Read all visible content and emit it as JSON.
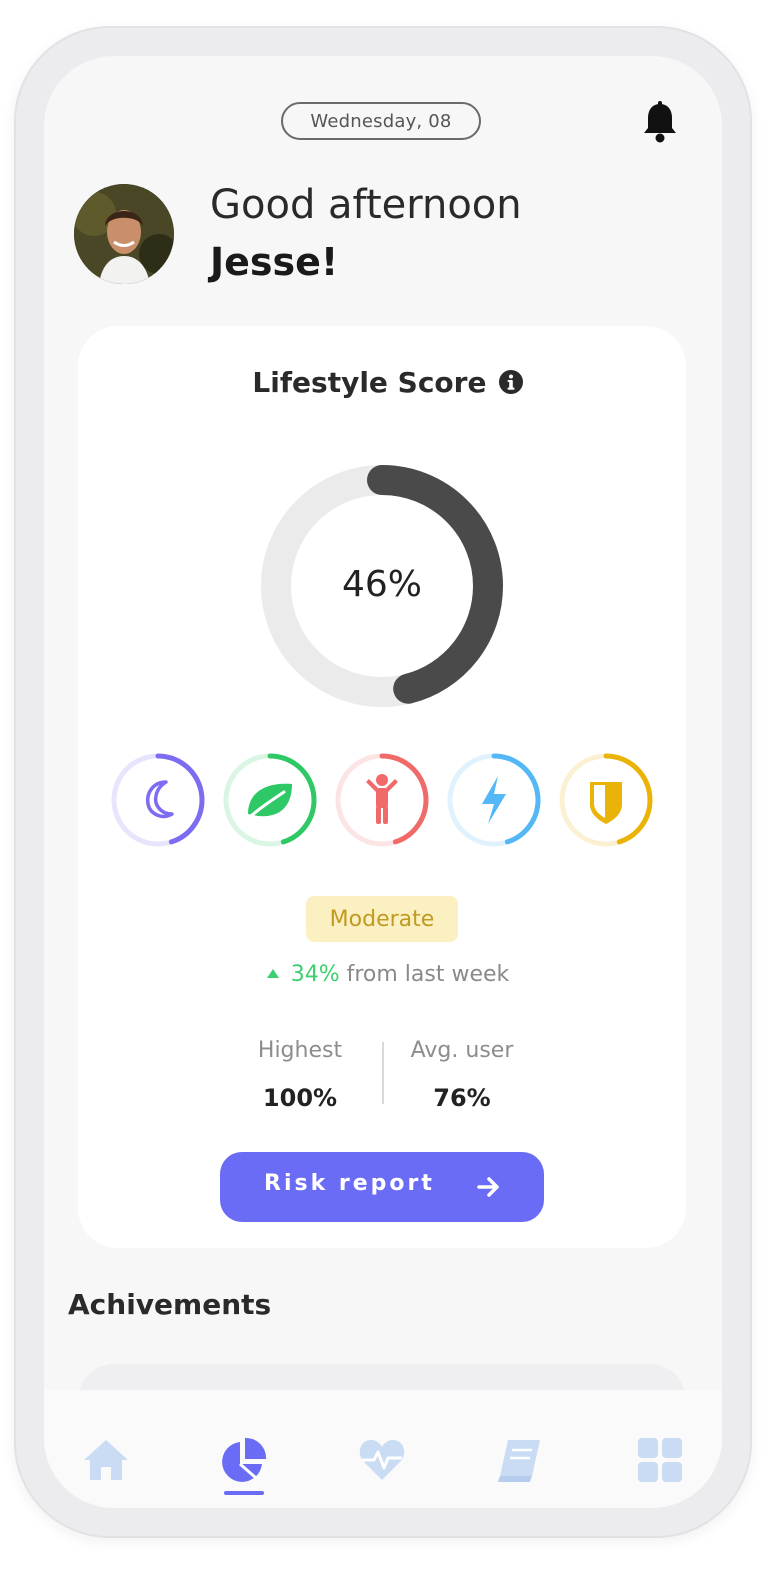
{
  "header": {
    "date": "Wednesday, 08",
    "notification_icon": "bell-icon"
  },
  "greeting": {
    "line1": "Good afternoon",
    "name": "Jesse!"
  },
  "lifestyle_score": {
    "title": "Lifestyle Score",
    "info_icon": "info-icon",
    "score_text": "46%",
    "score_value": 46,
    "ring_color": "#4a4a4a",
    "track_color": "#ebebeb",
    "categories": [
      {
        "icon": "moon-icon",
        "color": "#7b6cf2",
        "progress": 0.45
      },
      {
        "icon": "leaf-icon",
        "color": "#2fc866",
        "progress": 0.45
      },
      {
        "icon": "person-icon",
        "color": "#f06a6a",
        "progress": 0.45
      },
      {
        "icon": "lightning-icon",
        "color": "#53b8f5",
        "progress": 0.45
      },
      {
        "icon": "shield-icon",
        "color": "#eab308",
        "progress": 0.45
      }
    ],
    "status_badge": "Moderate",
    "change_value": "34%",
    "change_suffix": "from last week",
    "stats": {
      "highest_label": "Highest",
      "highest_value": "100%",
      "avg_label": "Avg. user",
      "avg_value": "76%"
    },
    "button_label": "Risk report",
    "accent": "#6a6cf5"
  },
  "achievements": {
    "title": "Achivements"
  },
  "tabbar": {
    "active": "insights",
    "items": [
      {
        "icon": "home-icon"
      },
      {
        "icon": "pie-chart-icon"
      },
      {
        "icon": "heart-pulse-icon"
      },
      {
        "icon": "book-icon"
      },
      {
        "icon": "grid-icon"
      }
    ]
  }
}
